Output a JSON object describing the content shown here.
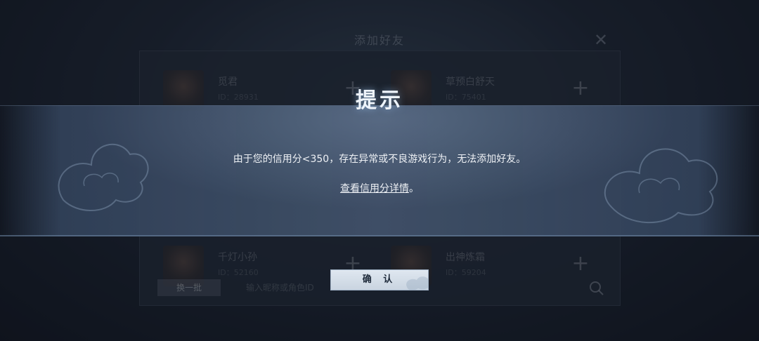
{
  "background": {
    "dialog_title": "添加好友",
    "friends": [
      {
        "name": "觅君",
        "id": "ID：28931"
      },
      {
        "name": "草预白舒天",
        "id": "ID：75401"
      },
      {
        "name": "千灯小孙",
        "id": "ID：52160"
      },
      {
        "name": "出神炼霜",
        "id": "ID：59204"
      }
    ],
    "swap_button": "换一批",
    "search_placeholder": "输入昵称或角色ID"
  },
  "prompt": {
    "title": "提示",
    "message": "由于您的信用分<350，存在异常或不良游戏行为，无法添加好友。",
    "detail_link": "查看信用分详情",
    "detail_suffix": "。",
    "confirm_label": "确 认"
  },
  "icons": {
    "close": "close-icon",
    "add": "plus-icon",
    "search": "search-icon"
  },
  "colors": {
    "banner": "#40506a",
    "title_glow": "#96bee6",
    "confirm_bg": "#dfe7f0",
    "confirm_text": "#1e2a3a"
  }
}
